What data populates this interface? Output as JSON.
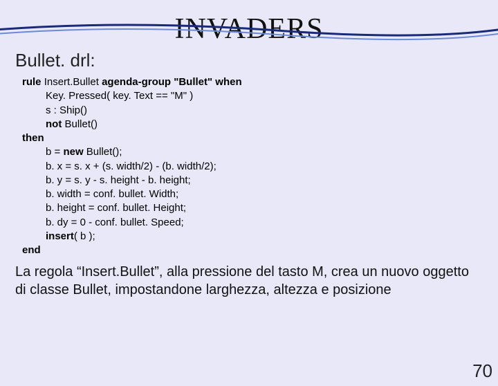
{
  "title": "INVADERS",
  "subtitle": "Bullet. drl:",
  "code": {
    "l1a": "rule ",
    "l1b": "Insert.Bullet ",
    "l1c": "agenda-group \"Bullet\" when",
    "l2": "Key. Pressed( key. Text == \"M\" )",
    "l3": "s : Ship()",
    "l4a": "not ",
    "l4b": "Bullet()",
    "l5": "then",
    "l6a": "b = ",
    "l6b": "new ",
    "l6c": "Bullet();",
    "l7": "b. x = s. x + (s. width/2) - (b. width/2);",
    "l8": "b. y = s. y - s. height - b. height;",
    "l9": "b. width = conf. bullet. Width;",
    "l10": "b. height = conf. bullet. Height;",
    "l11": "b. dy = 0 - conf. bullet. Speed;",
    "l12a": "insert",
    "l12b": "( b );",
    "l13": "end"
  },
  "desc": "La regola “Insert.Bullet”, alla pressione del tasto M, crea un nuovo oggetto di classe Bullet, impostandone larghezza, altezza e posizione",
  "pagenum": "70"
}
